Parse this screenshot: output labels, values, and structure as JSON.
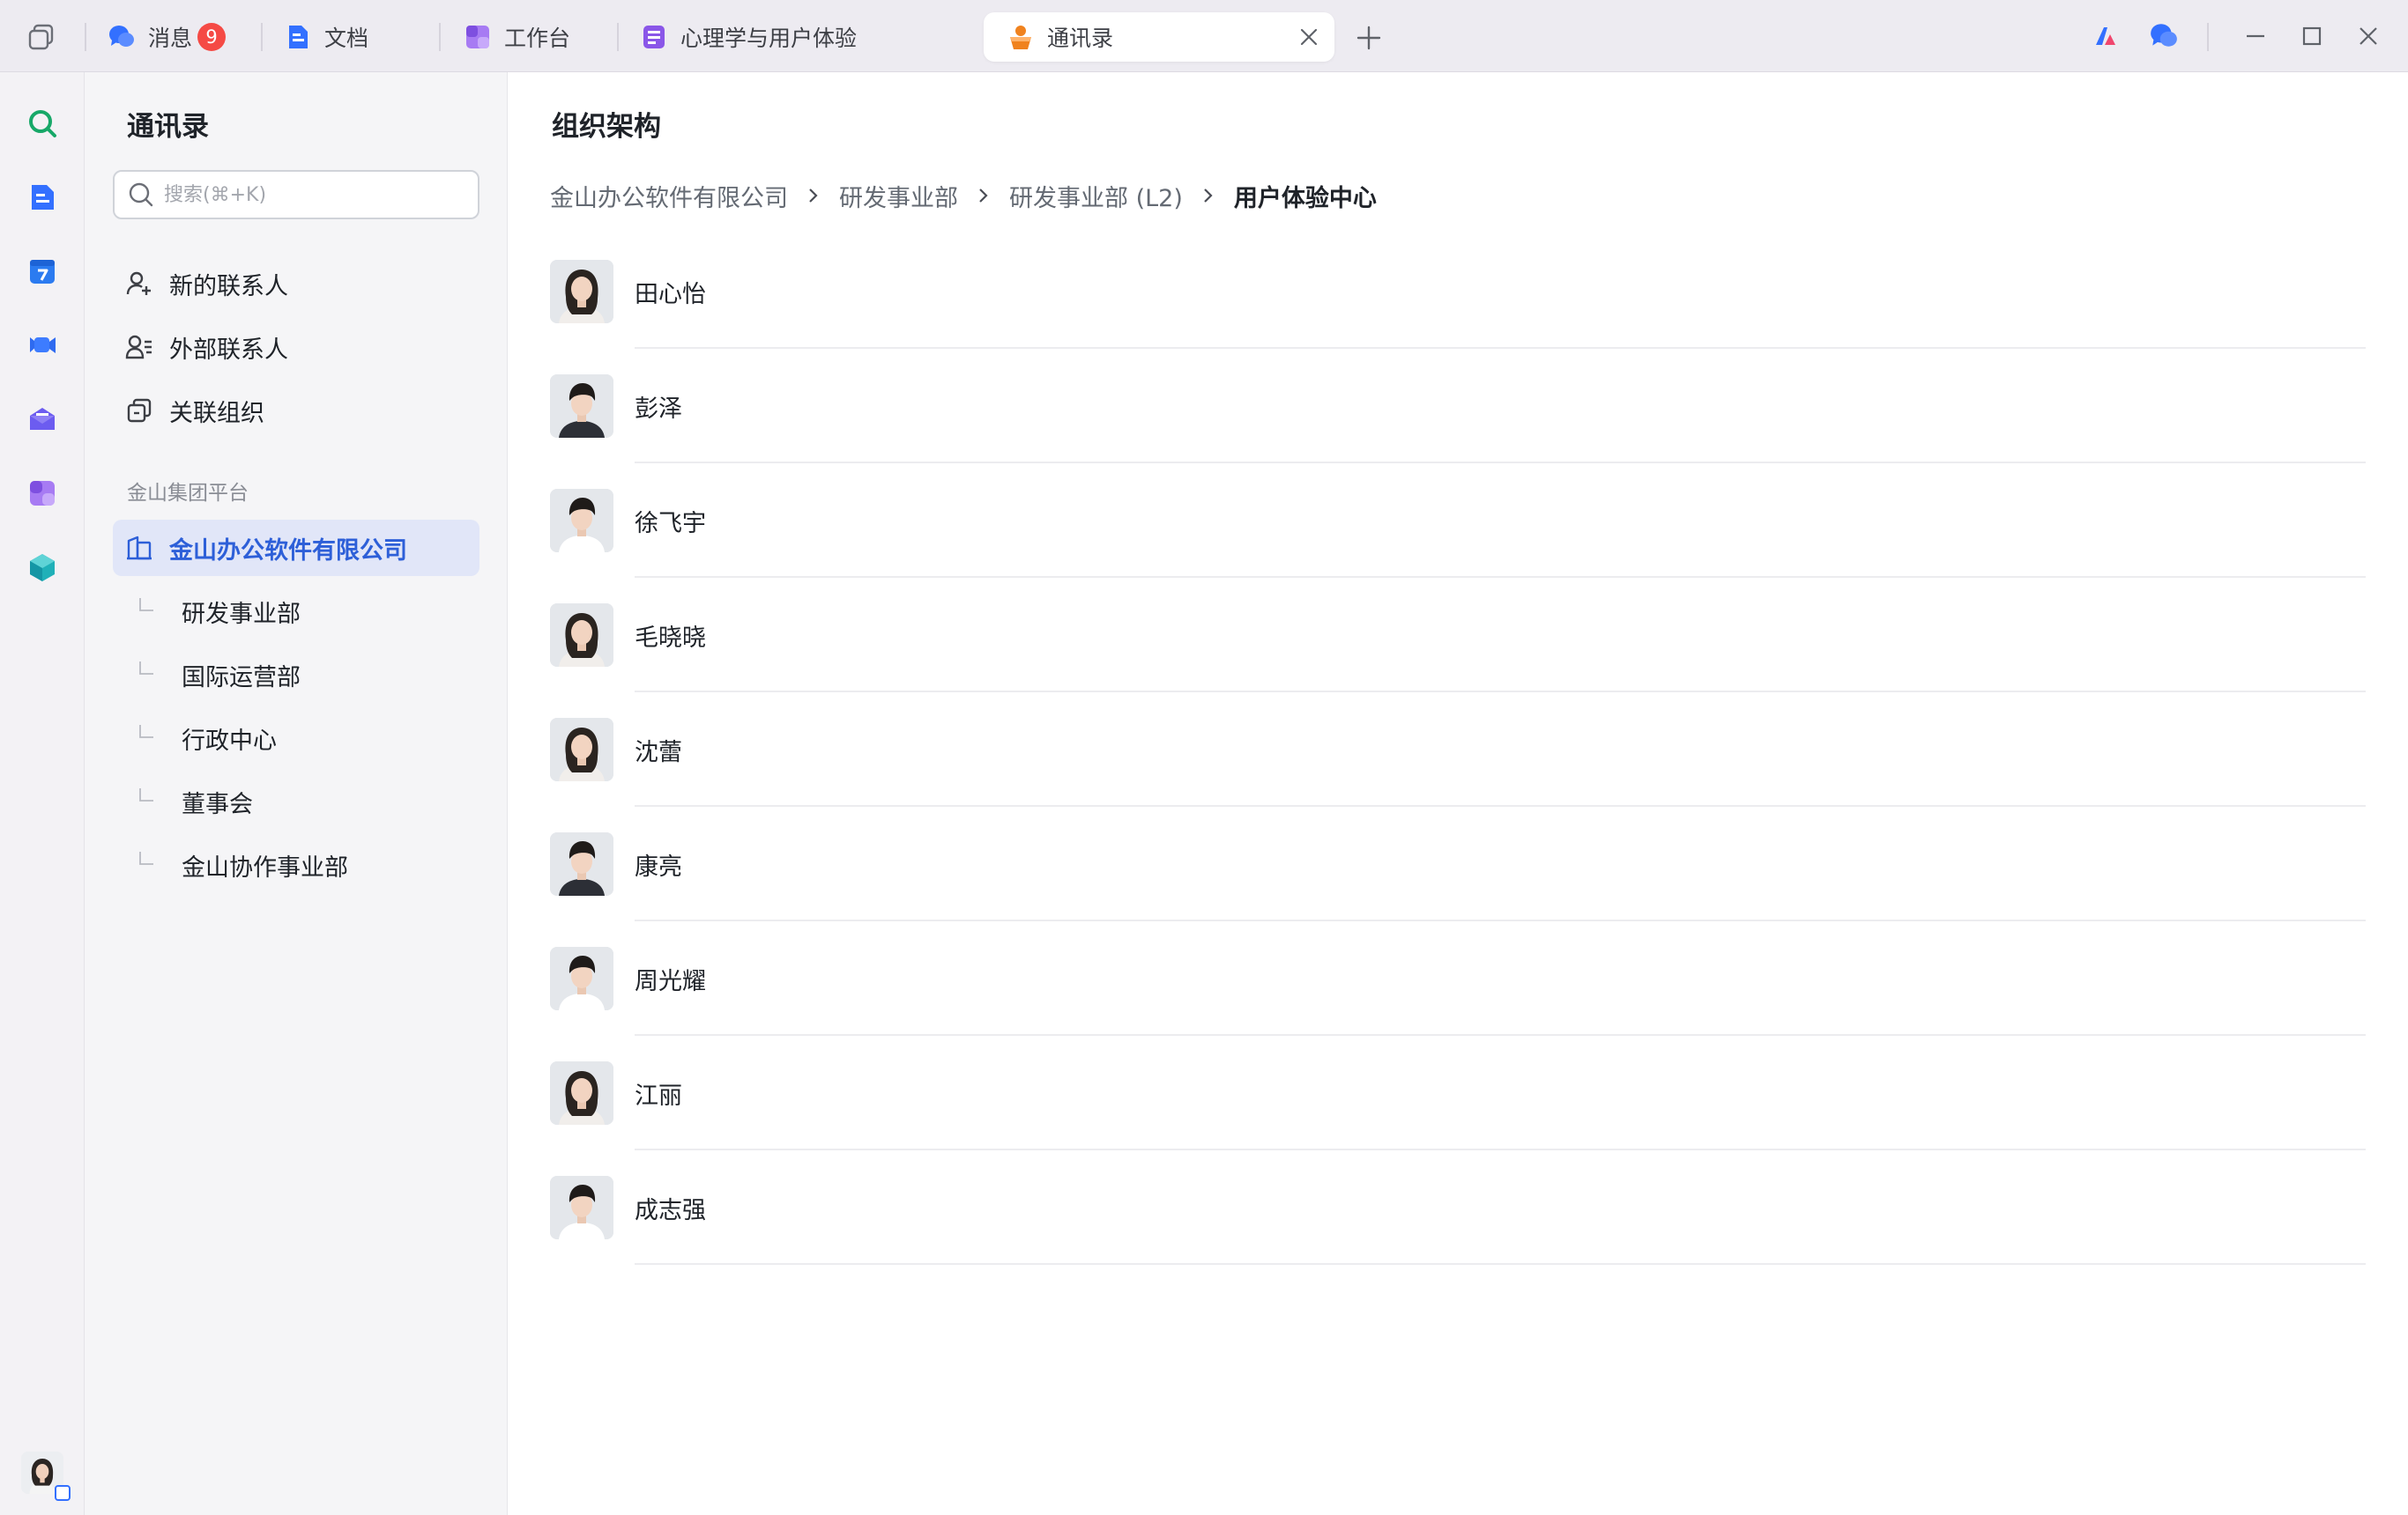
{
  "tabbar": {
    "tabs": [
      {
        "label": "消息",
        "icon": "chat-bubble-icon",
        "badge": "9"
      },
      {
        "label": "文档",
        "icon": "document-icon"
      },
      {
        "label": "工作台",
        "icon": "workspace-icon"
      },
      {
        "label": "心理学与用户体验",
        "icon": "doc-page-icon"
      },
      {
        "label": "通讯录",
        "icon": "contacts-icon",
        "active": true
      }
    ]
  },
  "sidebar": {
    "title": "通讯录",
    "search_placeholder": "搜索(⌘+K)",
    "items": [
      {
        "label": "新的联系人",
        "icon": "add-person-icon"
      },
      {
        "label": "外部联系人",
        "icon": "external-contacts-icon"
      },
      {
        "label": "关联组织",
        "icon": "linked-org-icon"
      }
    ],
    "section_label": "金山集团平台",
    "org": {
      "label": "金山办公软件有限公司",
      "icon": "building-icon"
    },
    "departments": [
      "研发事业部",
      "国际运营部",
      "行政中心",
      "董事会",
      "金山协作事业部"
    ]
  },
  "main": {
    "title": "组织架构",
    "breadcrumb": [
      "金山办公软件有限公司",
      "研发事业部",
      "研发事业部 (L2)",
      "用户体验中心"
    ],
    "contacts": [
      {
        "name": "田心怡",
        "gender": "f"
      },
      {
        "name": "彭泽",
        "gender": "m"
      },
      {
        "name": "徐飞宇",
        "gender": "m"
      },
      {
        "name": "毛晓晓",
        "gender": "f"
      },
      {
        "name": "沈蕾",
        "gender": "f"
      },
      {
        "name": "康亮",
        "gender": "m"
      },
      {
        "name": "周光耀",
        "gender": "m"
      },
      {
        "name": "江丽",
        "gender": "f"
      },
      {
        "name": "成志强",
        "gender": "m"
      }
    ]
  },
  "colors": {
    "accent": "#3370ff",
    "selected_bg": "#e1e6f8",
    "badge": "#f54a45",
    "titlebar_bg": "#edebf1"
  }
}
